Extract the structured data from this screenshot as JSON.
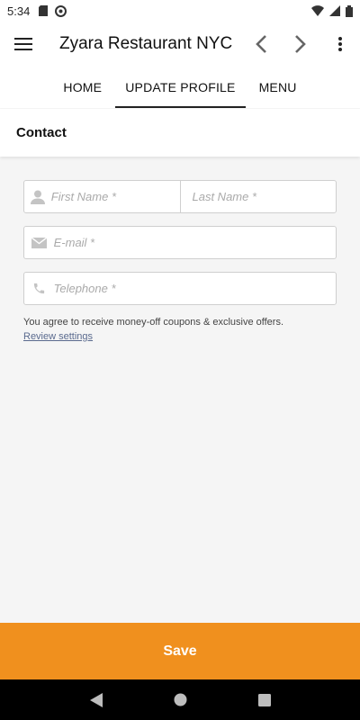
{
  "status_bar": {
    "time": "5:34"
  },
  "app_bar": {
    "title": "Zyara Restaurant NYC"
  },
  "tabs": [
    {
      "label": "HOME",
      "active": false
    },
    {
      "label": "UPDATE PROFILE",
      "active": true
    },
    {
      "label": "MENU",
      "active": false
    }
  ],
  "section": {
    "title": "Contact"
  },
  "form": {
    "first_name_placeholder": "First Name *",
    "last_name_placeholder": "Last Name *",
    "email_placeholder": "E-mail *",
    "telephone_placeholder": "Telephone *",
    "consent_text": "You agree to receive money-off coupons & exclusive offers.",
    "review_link": "Review settings"
  },
  "save_label": "Save",
  "colors": {
    "accent": "#f0901e",
    "link": "#5a6a8e"
  },
  "icons": [
    "menu-icon",
    "back-chevron-icon",
    "forward-chevron-icon",
    "more-vert-icon",
    "person-icon",
    "mail-icon",
    "phone-icon"
  ]
}
